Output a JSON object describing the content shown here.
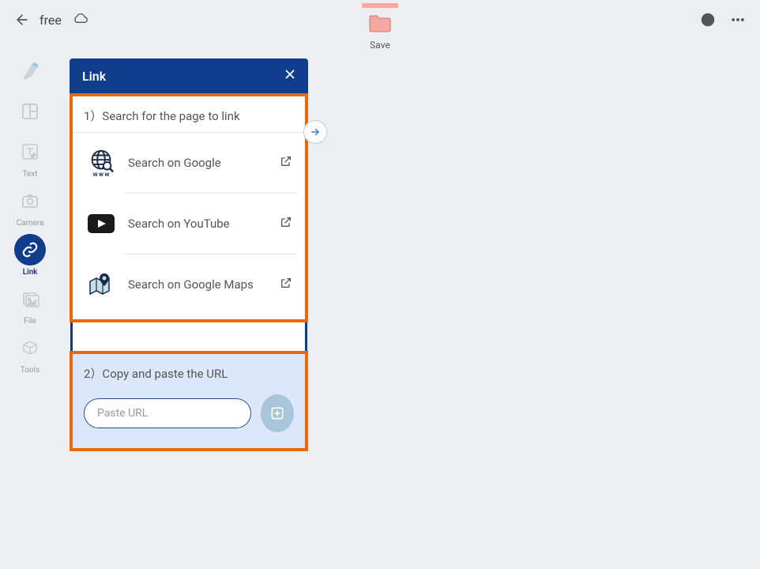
{
  "header": {
    "title": "free",
    "save_label": "Save"
  },
  "sidebar": {
    "items": [
      {
        "label": ""
      },
      {
        "label": ""
      },
      {
        "label": "Text"
      },
      {
        "label": "Camera"
      },
      {
        "label": "Link"
      },
      {
        "label": "File"
      },
      {
        "label": "Tools"
      }
    ]
  },
  "panel": {
    "title": "Link",
    "step1_title": "1）Search for the page to link",
    "search_options": [
      {
        "label": "Search on Google"
      },
      {
        "label": "Search on YouTube"
      },
      {
        "label": "Search on Google Maps"
      }
    ],
    "step2_title": "2）Copy and paste the URL",
    "url_placeholder": "Paste URL"
  }
}
